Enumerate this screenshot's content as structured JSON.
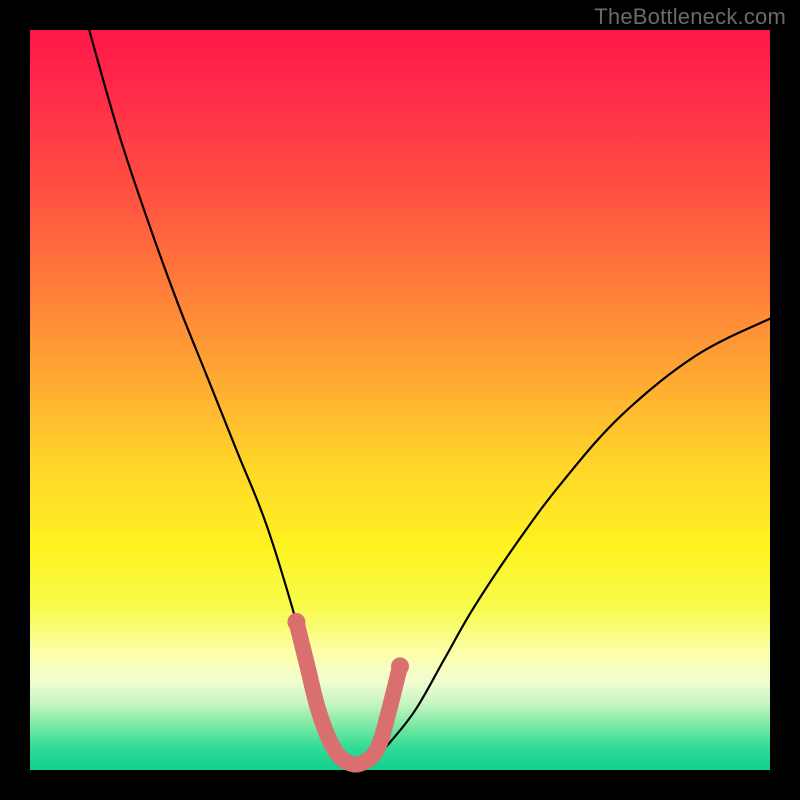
{
  "watermark": {
    "text": "TheBottleneck.com"
  },
  "chart_data": {
    "type": "line",
    "title": "",
    "xlabel": "",
    "ylabel": "",
    "xlim": [
      0,
      100
    ],
    "ylim": [
      0,
      100
    ],
    "series": [
      {
        "name": "bottleneck-curve",
        "x": [
          8,
          12,
          16,
          20,
          24,
          28,
          32,
          36,
          38,
          40,
          42,
          44,
          46,
          48,
          52,
          56,
          60,
          66,
          72,
          80,
          90,
          100
        ],
        "y": [
          100,
          86,
          74,
          63,
          53,
          43,
          33,
          20,
          12,
          6,
          2,
          1,
          1,
          3,
          8,
          15,
          22,
          31,
          39,
          48,
          56,
          61
        ]
      }
    ],
    "highlight": {
      "name": "near-zero-band",
      "color": "#d96f6f",
      "points_x": [
        36,
        37.5,
        39,
        41,
        43,
        45,
        47,
        48.5,
        50
      ],
      "points_y": [
        20,
        14,
        8,
        3,
        1,
        1,
        3,
        8,
        14
      ]
    }
  }
}
